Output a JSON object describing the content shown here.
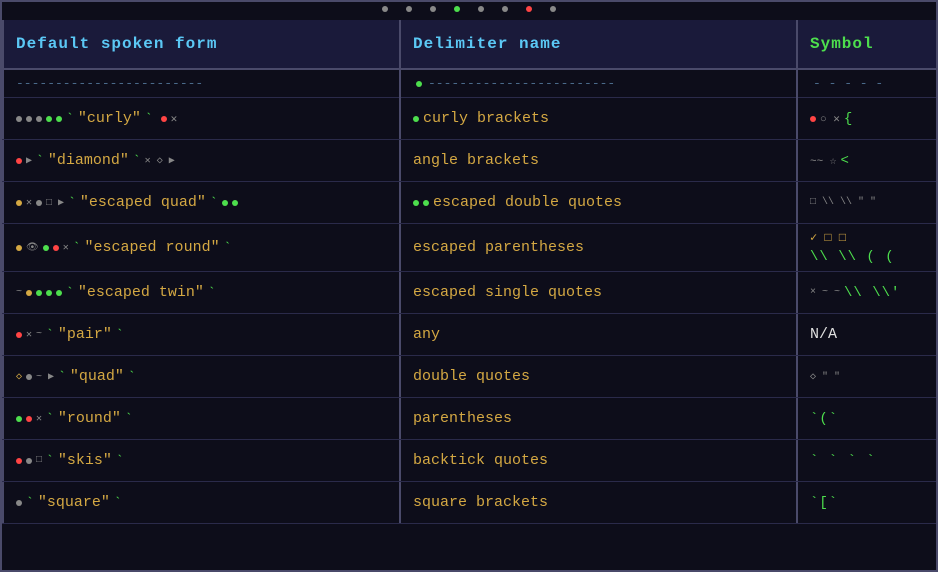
{
  "header": {
    "col1": "Default spoken form",
    "col2": "Delimiter name",
    "col3": "Symbol",
    "top_dots": [
      "gray",
      "gray",
      "gray",
      "green",
      "gray",
      "gray",
      "red",
      "gray"
    ]
  },
  "separator": {
    "dashes": "------------------------",
    "dashes2": "------------------------",
    "dashes3": "- - - - - -"
  },
  "rows": [
    {
      "default": "`\"curly\"`",
      "delimiter": "curly brackets",
      "symbol": "{",
      "deco_left": [
        "dot-gray",
        "dot-gray",
        "dot-gray",
        "dot-green",
        "dot-green"
      ],
      "deco_right": [
        "dot-red",
        "x",
        "dot-green"
      ],
      "symbol_deco": "{ "
    },
    {
      "default": "`\"diamond\"`",
      "delimiter": "angle brackets",
      "symbol": "<",
      "deco_left": [
        "dot-red",
        "arrow"
      ],
      "deco_right": [
        "tilde",
        "arrow",
        "star"
      ],
      "symbol_deco": "~~ <"
    },
    {
      "default": "`\"escaped quad\"`",
      "delimiter": "escaped double quotes",
      "symbol": "\\\\\"\"",
      "deco_left": [
        "dot-yellow",
        "x",
        "dot-gray",
        "sq",
        "arrow"
      ],
      "deco_right": [
        "dot-green",
        "dot-green"
      ],
      "symbol_deco": "\\\\\"\"  "
    },
    {
      "default": "`\"escaped round\"`",
      "delimiter": "escaped parentheses",
      "symbol": "\\\\((",
      "deco_left": [
        "dot-yellow",
        "eye",
        "dot-green",
        "dot-red",
        "x"
      ],
      "symbol_deco": "\\\\(( "
    },
    {
      "default": "`\"escaped twin\"`",
      "delimiter": "escaped single quotes",
      "symbol": "\\\\'",
      "deco_left": [
        "tilde",
        "dot-yellow",
        "dot-green",
        "dot-green",
        "dot-green"
      ],
      "symbol_deco": "\\\\'  "
    },
    {
      "default": "`\"pair\"`",
      "delimiter": "any",
      "symbol": "N/A",
      "deco_left": [
        "dot-red",
        "x"
      ],
      "symbol_deco": "N/A"
    },
    {
      "default": "`\"quad\"`",
      "delimiter": "double quotes",
      "symbol": "\"\"",
      "deco_left": [
        "diamond",
        "dot-gray",
        "arrow"
      ],
      "symbol_deco": "\"\" "
    },
    {
      "default": "`\"round\"`",
      "delimiter": "parentheses",
      "symbol": "`(`",
      "deco_left": [
        "dot-green",
        "dot-red",
        "x"
      ],
      "symbol_deco": "`(` "
    },
    {
      "default": "`\"skis\"`",
      "delimiter": "backtick quotes",
      "symbol": "``",
      "deco_left": [
        "dot-red",
        "dot-gray",
        "sq"
      ],
      "symbol_deco": "`` ` ` "
    },
    {
      "default": "`\"square\"`",
      "delimiter": "square brackets",
      "symbol": "`[`",
      "deco_left": [
        "dot-gray"
      ],
      "symbol_deco": "`[` "
    }
  ]
}
